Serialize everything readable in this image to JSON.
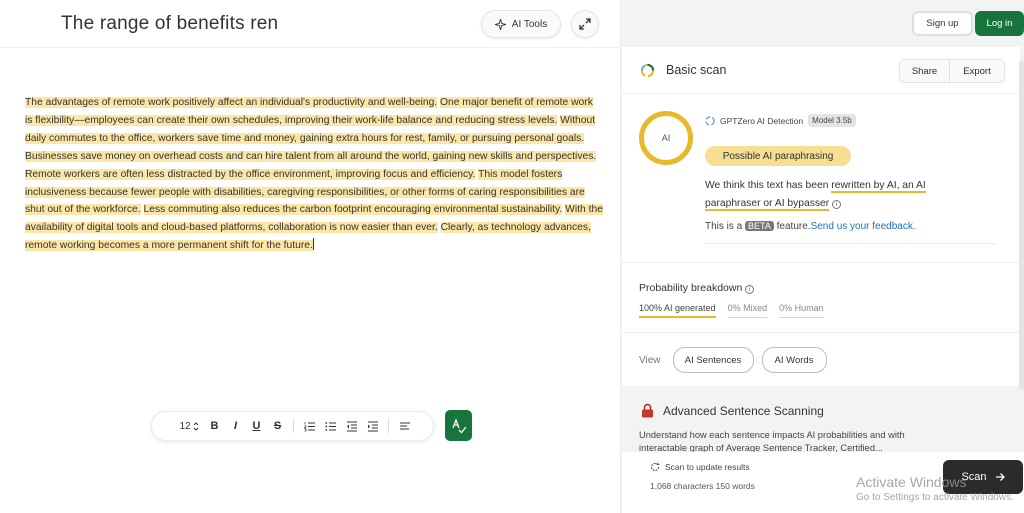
{
  "editor": {
    "title": "The range of benefits ren",
    "ai_tools_label": "AI Tools",
    "paragraph_sentences": [
      "The advantages of remote work positively affect an individual's productivity and well-being.",
      "One major benefit of remote work is flexibility—employees can create their own schedules, improving their work-life balance and reducing stress levels.",
      "Without daily commutes to the office, workers save time and money, gaining extra hours for rest, family, or pursuing personal goals.",
      "Businesses save money on overhead costs and can hire talent from all around the world, gaining new skills and perspectives.",
      "Remote workers are often less distracted by the office environment, improving focus and efficiency.",
      "This model fosters inclusiveness because fewer people with disabilities, caregiving responsibilities, or other forms of caring responsibilities are shut out of the workforce.",
      "Less commuting also reduces the carbon footprint encouraging environmental sustainability.",
      "With the availability of digital tools and cloud-based platforms, collaboration is now easier than ever.",
      "Clearly, as technology advances, remote working becomes a more permanent shift for the future."
    ],
    "highlight_color": "#fbe6a6",
    "toolbar": {
      "font_size": "12",
      "bold": "B",
      "italic": "I",
      "underline": "U",
      "strike": "S"
    }
  },
  "header": {
    "signup_label": "Sign up",
    "login_label": "Log in"
  },
  "scan": {
    "title": "Basic scan",
    "share_label": "Share",
    "export_label": "Export",
    "ring_label": "AI",
    "detector_name": "GPTZero AI Detection",
    "model_badge": "Model 3.5b",
    "verdict": "Possible AI paraphrasing",
    "explain_prefix": "We think this text has been",
    "explain_highlight": "rewritten by AI, an AI paraphraser or AI bypasser",
    "beta_prefix": "This is a",
    "beta_badge": "BETA",
    "beta_suffix": "feature.",
    "feedback_link": "Send us your feedback."
  },
  "probability": {
    "title": "Probability breakdown",
    "tabs": [
      "100% AI generated",
      "0% Mixed",
      "0% Human"
    ],
    "accent_color": "#e8b92c"
  },
  "view": {
    "label": "View",
    "options": [
      "AI Sentences",
      "AI Words"
    ]
  },
  "advanced": {
    "title": "Advanced Sentence Scanning",
    "text": "Understand how each sentence impacts AI probabilities and with interactable graph of Average Sentence Tracker, Certified..."
  },
  "footer": {
    "scan_update": "Scan to update results",
    "counts": "1,068 characters 150 words",
    "scan_label": "Scan"
  },
  "watermark": {
    "line1": "Activate Windows",
    "line2": "Go to Settings to activate Windows."
  },
  "colors": {
    "brand_green": "#16743c",
    "ai_yellow": "#e8b92c",
    "link_blue": "#1f6fbf"
  }
}
